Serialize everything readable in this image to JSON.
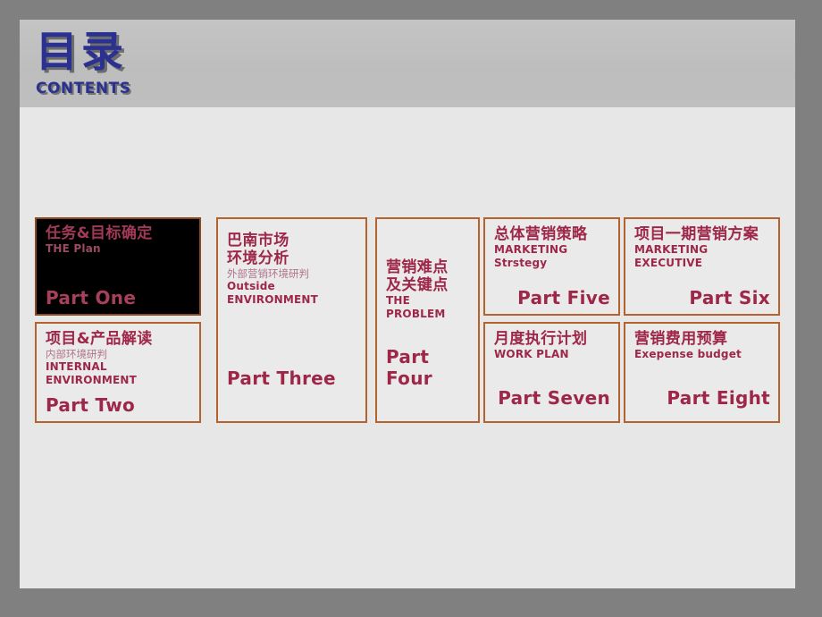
{
  "slide": {
    "header": {
      "title": "目录",
      "subtitle": "CONTENTS",
      "title_color": "#2b3190",
      "band_color": "#c0c0c0"
    },
    "background_color": "#e7e7e7",
    "outer_frame_color": "#808080",
    "accent_color": "#9e2749",
    "card_border_color": "#b4632f"
  },
  "cards": [
    {
      "id": "card-part-one",
      "cn_title": "任务&目标确定",
      "cn_subtitle": "",
      "en_subtitle": "THE Plan",
      "part_label": "Part One",
      "part_align": "left",
      "theme": "dark"
    },
    {
      "id": "card-part-two",
      "cn_title": "项目&产品解读",
      "cn_subtitle": "内部环境研判",
      "en_subtitle": "INTERNAL\nENVIRONMENT",
      "en_subtitle_line1": "INTERNAL",
      "en_subtitle_line2": "ENVIRONMENT",
      "part_label": "Part Two",
      "part_align": "left",
      "theme": "light"
    },
    {
      "id": "card-part-three",
      "cn_title": "巴南市场\n环境分析",
      "cn_title_line1": "巴南市场",
      "cn_title_line2": "环境分析",
      "cn_subtitle": "外部营销环境研判",
      "en_subtitle": "Outside ENVIRONMENT",
      "part_label": "Part Three",
      "part_align": "left",
      "theme": "light"
    },
    {
      "id": "card-part-four",
      "cn_title": "营销难点\n及关键点",
      "cn_title_line1": "营销难点",
      "cn_title_line2": "及关键点",
      "cn_subtitle": "",
      "en_subtitle": "THE  PROBLEM",
      "part_label": "Part Four",
      "part_align": "left",
      "theme": "light"
    },
    {
      "id": "card-part-five",
      "cn_title": "总体营销策略",
      "cn_subtitle": "",
      "en_subtitle_line1": "MARKETING",
      "en_subtitle_line2": "Strstegy",
      "part_label": "Part Five",
      "part_align": "right",
      "theme": "light"
    },
    {
      "id": "card-part-six",
      "cn_title": "项目一期营销方案",
      "cn_subtitle": "",
      "en_subtitle": "MARKETING EXECUTIVE",
      "part_label": "Part Six",
      "part_align": "right",
      "theme": "light"
    },
    {
      "id": "card-part-seven",
      "cn_title": "月度执行计划",
      "cn_subtitle": "",
      "en_subtitle": "WORK PLAN",
      "part_label": "Part Seven",
      "part_align": "right",
      "theme": "light"
    },
    {
      "id": "card-part-eight",
      "cn_title": "营销费用预算",
      "cn_subtitle": "",
      "en_subtitle": "Exepense budget",
      "part_label": "Part Eight",
      "part_align": "right",
      "theme": "light"
    }
  ]
}
